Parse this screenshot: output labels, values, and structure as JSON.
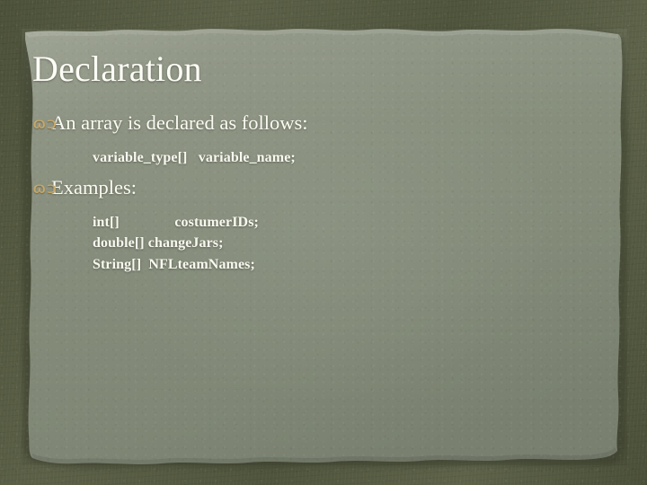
{
  "slide": {
    "title": "Declaration",
    "bullet_glyph": "ɷɔ",
    "accent_color": "#c8a86a",
    "text_color": "#fbfbf4",
    "paper_color": "#8a9180",
    "border_color": "#53593f",
    "blocks": [
      {
        "bullet": "An array is declared as follows:",
        "lines": [
          "variable_type[]   variable_name;"
        ]
      },
      {
        "bullet": "Examples:",
        "lines": [
          "int[]               costumerIDs;",
          "double[] changeJars;",
          "String[]  NFLteamNames;"
        ]
      }
    ]
  }
}
